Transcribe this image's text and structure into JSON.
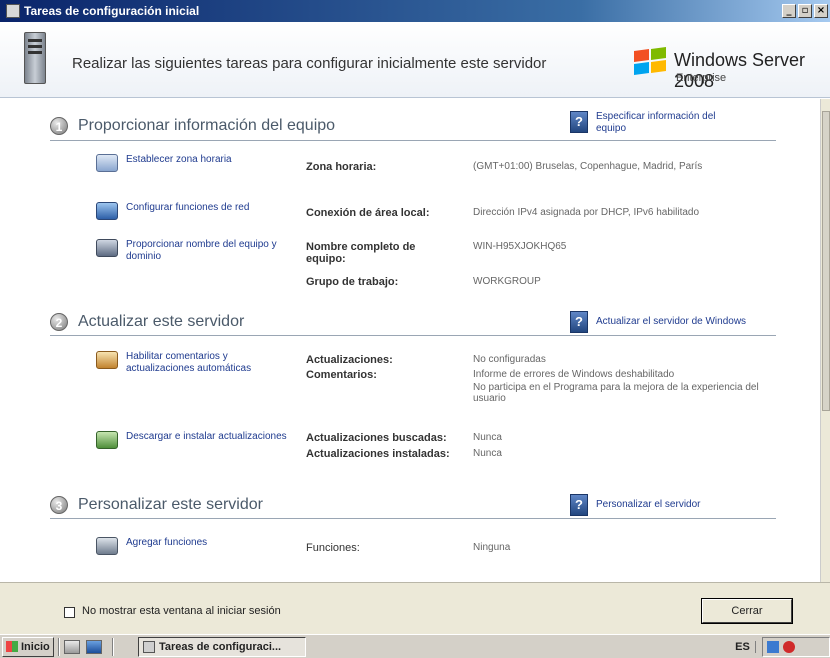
{
  "window": {
    "title": "Tareas de configuración inicial"
  },
  "header": {
    "text": "Realizar las siguientes tareas para configurar inicialmente este servidor",
    "brand": "Windows Server 2008",
    "edition": "Enterprise"
  },
  "sections": [
    {
      "number": "1",
      "title": "Proporcionar información del equipo",
      "help": "Especificar información del equipo",
      "tasks": [
        {
          "link": "Establecer zona horaria",
          "labels": [
            "Zona horaria:"
          ],
          "values": [
            "(GMT+01:00) Bruselas, Copenhague, Madrid, París"
          ]
        },
        {
          "link": "Configurar funciones de red",
          "labels": [
            "Conexión de área local:"
          ],
          "values": [
            "Dirección IPv4 asignada por DHCP, IPv6 habilitado"
          ]
        },
        {
          "link": "Proporcionar nombre del equipo y dominio",
          "labels": [
            "Nombre completo de equipo:",
            "Grupo de trabajo:"
          ],
          "values": [
            "WIN-H95XJOKHQ65",
            "WORKGROUP"
          ]
        }
      ]
    },
    {
      "number": "2",
      "title": "Actualizar este servidor",
      "help": "Actualizar el servidor de Windows",
      "tasks": [
        {
          "link": "Habilitar comentarios y actualizaciones automáticas",
          "labels": [
            "Actualizaciones:",
            "Comentarios:"
          ],
          "values": [
            "No configuradas",
            "Informe de errores de Windows deshabilitado",
            "No participa en el Programa para la mejora de la experiencia del usuario"
          ]
        },
        {
          "link": "Descargar e instalar actualizaciones",
          "labels": [
            "Actualizaciones buscadas:",
            "Actualizaciones instaladas:"
          ],
          "values": [
            "Nunca",
            "Nunca"
          ]
        }
      ]
    },
    {
      "number": "3",
      "title": "Personalizar este servidor",
      "help": "Personalizar el servidor",
      "tasks": [
        {
          "link": "Agregar funciones",
          "labels": [
            "Funciones:"
          ],
          "values": [
            "Ninguna"
          ]
        }
      ]
    }
  ],
  "footer": {
    "checkbox_label": "No mostrar esta ventana al iniciar sesión",
    "close_button": "Cerrar"
  },
  "taskbar": {
    "start": "Inicio",
    "task_button": "Tareas de configuraci...",
    "lang": "ES"
  },
  "colors": {
    "title_bar": "#0a246a",
    "link": "#1f3b8f",
    "section_title": "#4b5a6a"
  }
}
